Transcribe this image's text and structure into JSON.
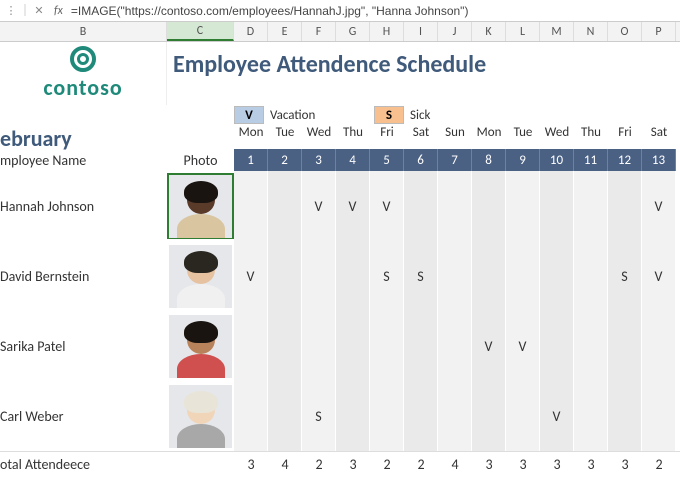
{
  "formula_bar": {
    "fx": "fx",
    "formula": "=IMAGE(\"https://contoso.com/employees/HannahJ.jpg\", \"Hanna Johnson\")"
  },
  "columns": [
    "B",
    "C",
    "D",
    "E",
    "F",
    "G",
    "H",
    "I",
    "J",
    "K",
    "L",
    "M",
    "N",
    "O",
    "P"
  ],
  "selected_column": "C",
  "brand": "contoso",
  "title": "Employee Attendence Schedule",
  "legend": {
    "vac_badge": "V",
    "vac_label": "Vacation",
    "sick_badge": "S",
    "sick_label": "Sick"
  },
  "month": "ebruary",
  "headers": {
    "emp": "mployee Name",
    "photo": "Photo",
    "days": [
      "Mon",
      "Tue",
      "Wed",
      "Thu",
      "Fri",
      "Sat",
      "Sun",
      "Mon",
      "Tue",
      "Wed",
      "Thu",
      "Fri",
      "Sat"
    ],
    "dates": [
      "1",
      "2",
      "3",
      "4",
      "5",
      "6",
      "7",
      "8",
      "9",
      "10",
      "11",
      "12",
      "13"
    ]
  },
  "employees": [
    {
      "name": "Hannah Johnson",
      "skin": "#5a3a28",
      "hair": "#1a1410",
      "shirt": "#d9c5a0",
      "att": [
        "",
        "",
        "V",
        "V",
        "V",
        "",
        "",
        "",
        "",
        "",
        "",
        "",
        "V"
      ]
    },
    {
      "name": "David Bernstein",
      "skin": "#e6c2a0",
      "hair": "#2a2620",
      "shirt": "#f0f0f0",
      "att": [
        "V",
        "",
        "",
        "",
        "S",
        "S",
        "",
        "",
        "",
        "",
        "",
        "S",
        "V"
      ]
    },
    {
      "name": "Sarika Patel",
      "skin": "#b8825a",
      "hair": "#1a1410",
      "shirt": "#d05050",
      "att": [
        "",
        "",
        "",
        "",
        "",
        "",
        "",
        "V",
        "V",
        "",
        "",
        "",
        ""
      ]
    },
    {
      "name": "Carl Weber",
      "skin": "#f0d5b8",
      "hair": "#e8e4d8",
      "shirt": "#a8a8a8",
      "att": [
        "",
        "",
        "S",
        "",
        "",
        "",
        "",
        "",
        "",
        "V",
        "",
        "",
        ""
      ]
    }
  ],
  "totals": {
    "label": "otal Attendeece",
    "values": [
      "3",
      "4",
      "2",
      "3",
      "2",
      "2",
      "4",
      "3",
      "3",
      "3",
      "3",
      "3",
      "2"
    ]
  }
}
